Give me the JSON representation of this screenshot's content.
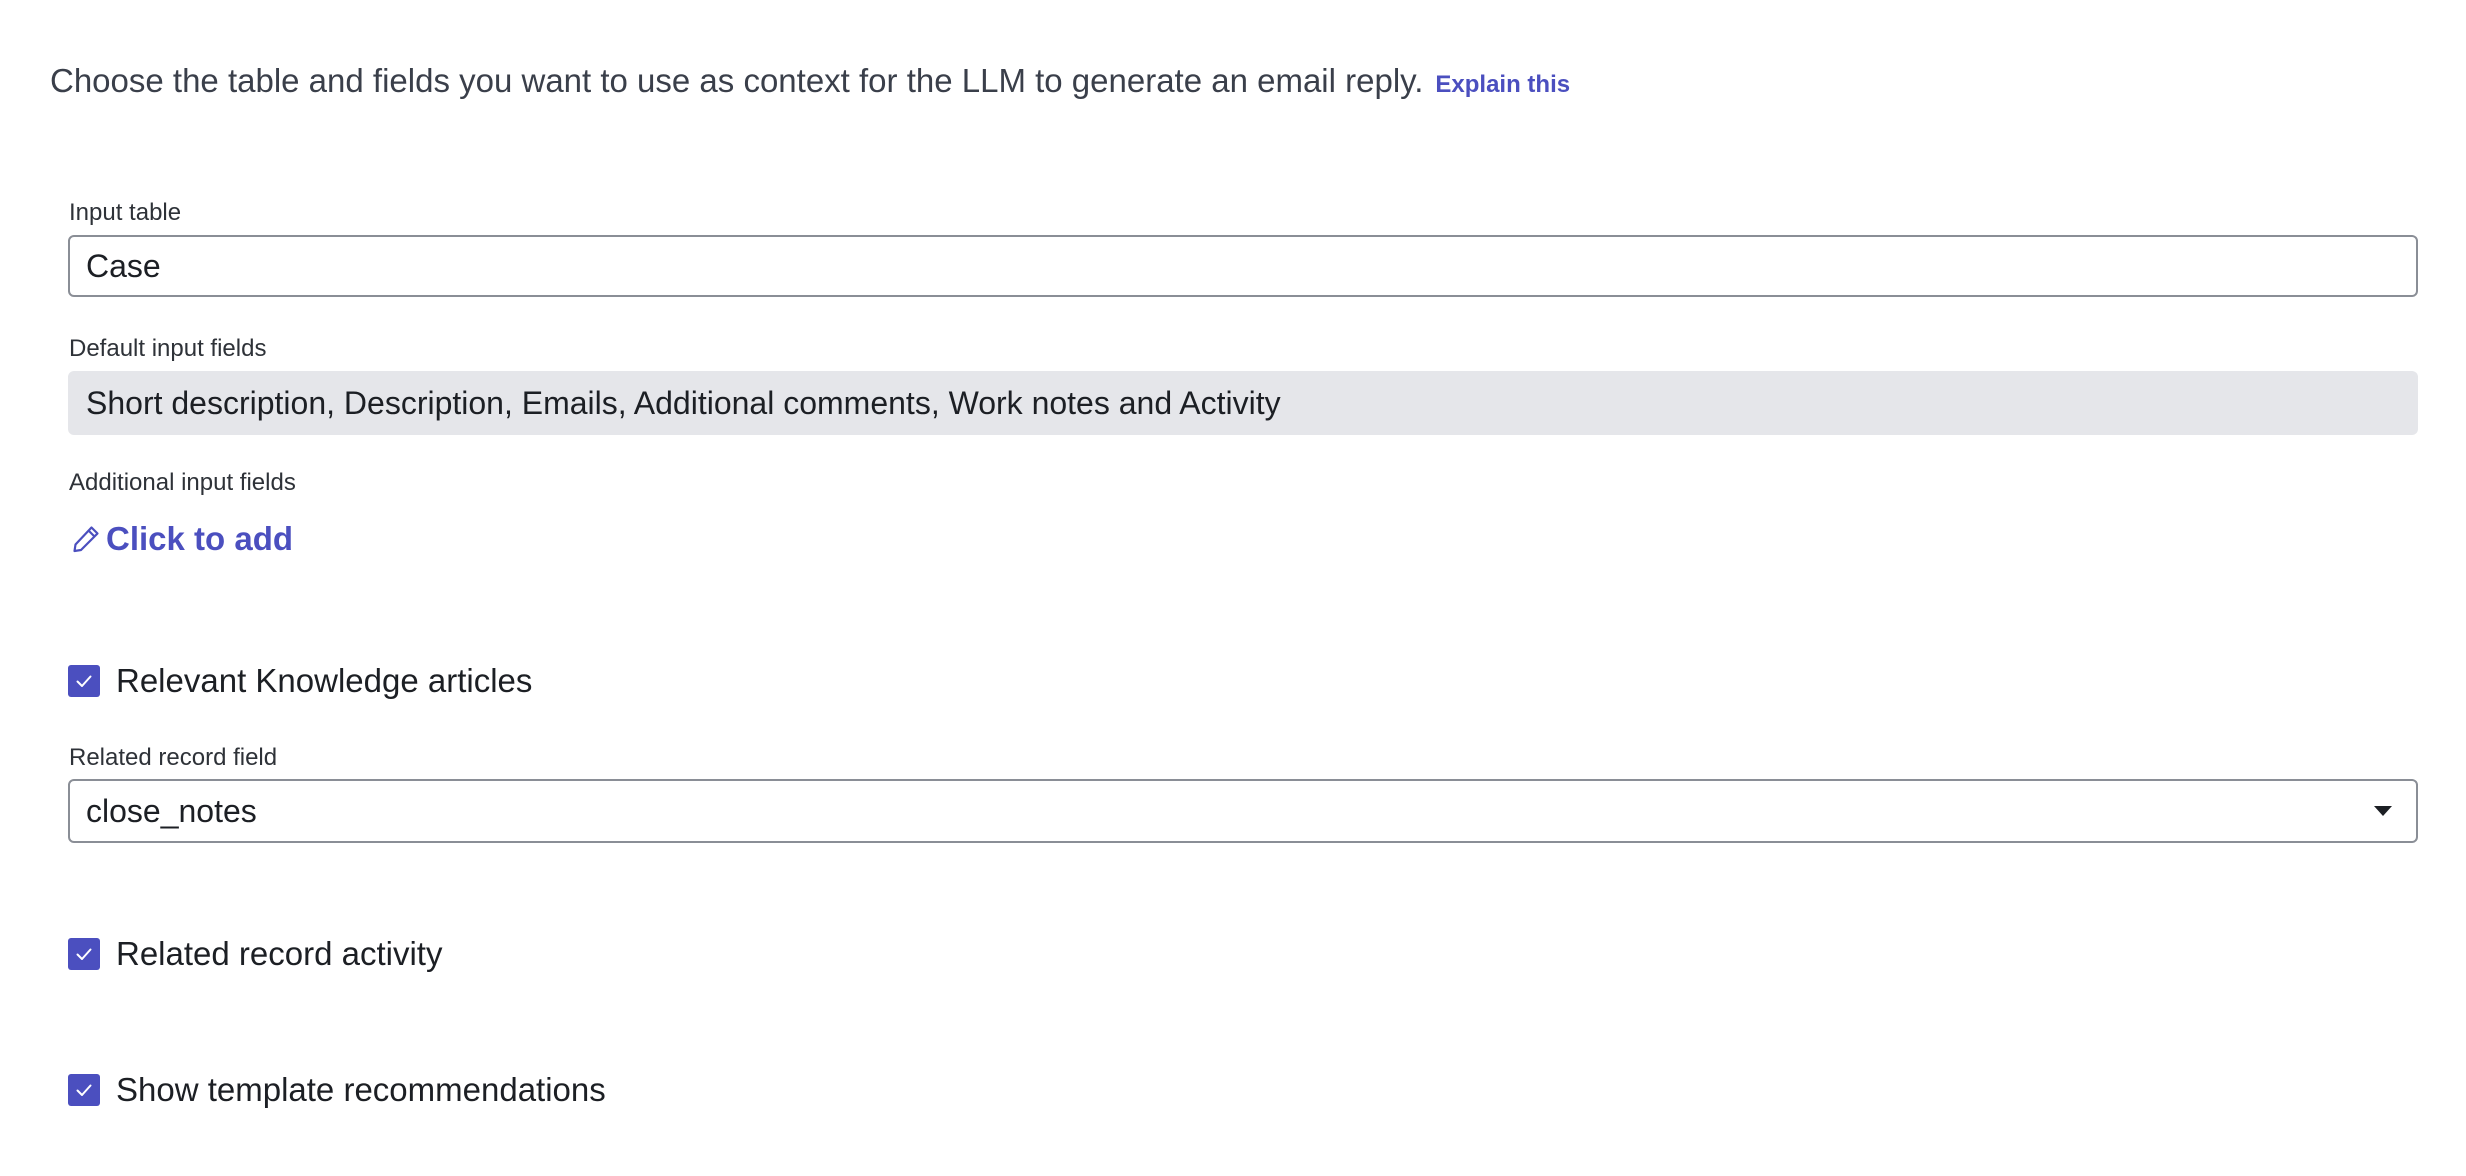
{
  "intro": {
    "text": "Choose the table and fields you want to use as context for the LLM to generate an email reply.",
    "explain_link": "Explain this"
  },
  "input_table": {
    "label": "Input table",
    "value": "Case"
  },
  "default_input_fields": {
    "label": "Default input fields",
    "value": "Short description, Description, Emails, Additional comments, Work notes and Activity"
  },
  "additional_input_fields": {
    "label": "Additional input fields",
    "add_link": "Click to add",
    "icon": "pencil-icon"
  },
  "relevant_knowledge": {
    "label": "Relevant Knowledge articles",
    "checked": true
  },
  "related_record_field": {
    "label": "Related record field",
    "selected": "close_notes",
    "icon": "chevron-down-icon"
  },
  "related_record_activity": {
    "label": "Related record activity",
    "checked": true
  },
  "template_recommendations": {
    "label": "Show template recommendations",
    "checked": true
  },
  "colors": {
    "accent": "#4b4fbf",
    "readonly_bg": "#e5e6ea",
    "border": "#8a8e96"
  }
}
